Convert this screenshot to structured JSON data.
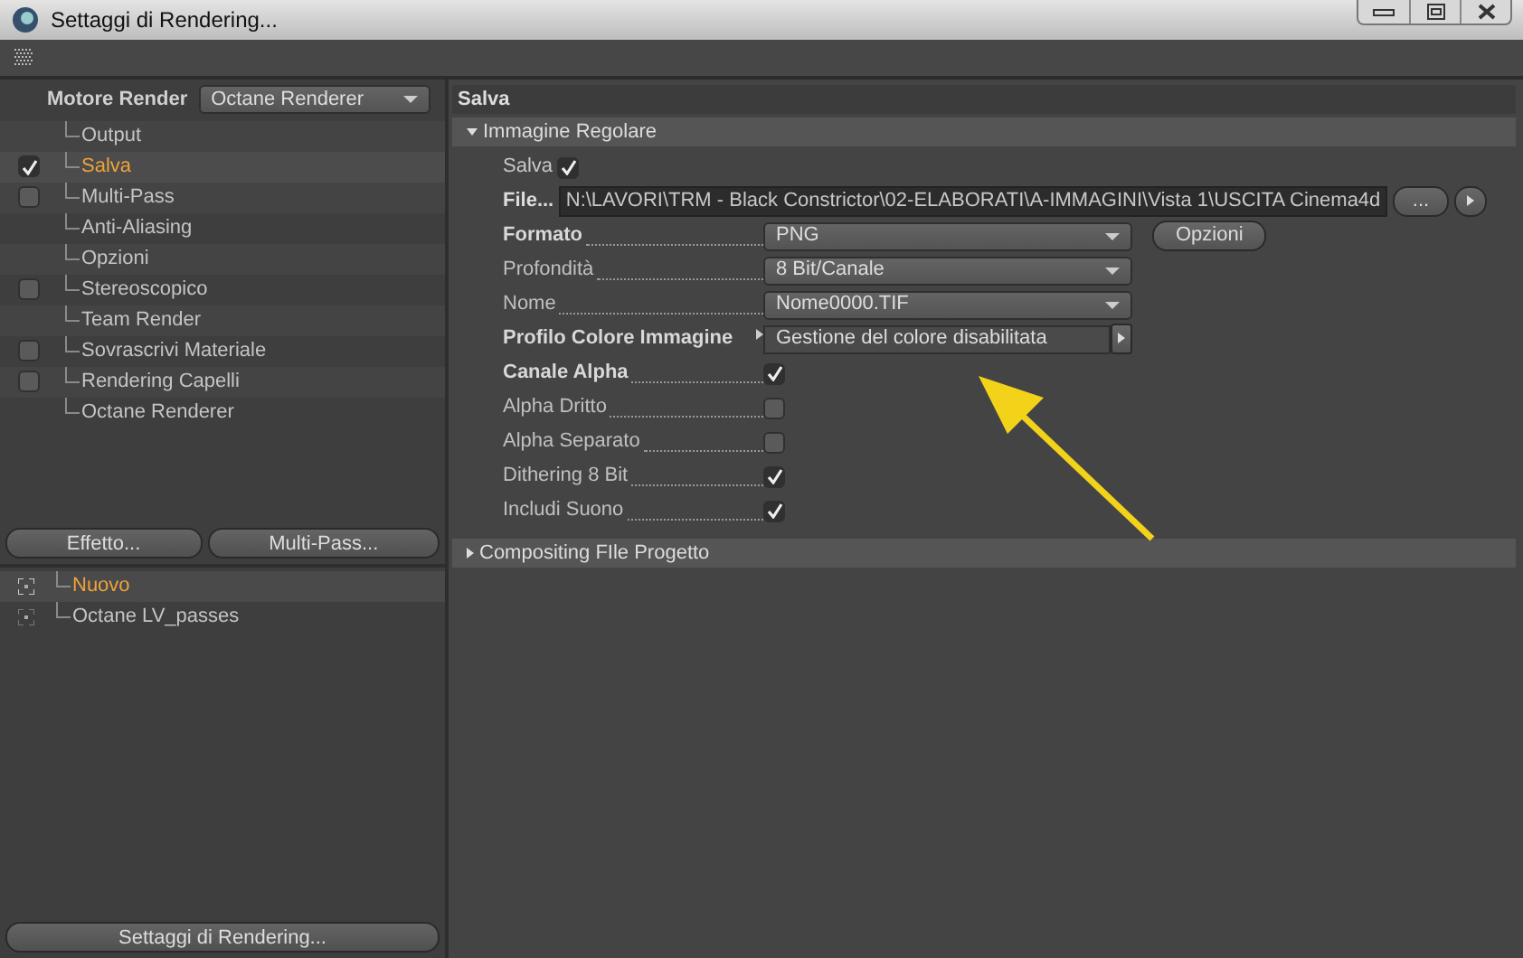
{
  "window": {
    "title": "Settaggi di Rendering..."
  },
  "sidebar": {
    "engine_label": "Motore Render",
    "engine_value": "Octane Renderer",
    "items": [
      {
        "label": "Output",
        "kind": "plain",
        "selected": false
      },
      {
        "label": "Salva",
        "kind": "checkbox",
        "checked": true,
        "selected": true
      },
      {
        "label": "Multi-Pass",
        "kind": "checkbox",
        "checked": false,
        "selected": false
      },
      {
        "label": "Anti-Aliasing",
        "kind": "plain",
        "selected": false
      },
      {
        "label": "Opzioni",
        "kind": "plain",
        "selected": false
      },
      {
        "label": "Stereoscopico",
        "kind": "checkbox",
        "checked": false,
        "selected": false
      },
      {
        "label": "Team Render",
        "kind": "plain",
        "selected": false
      },
      {
        "label": "Sovrascrivi Materiale",
        "kind": "checkbox",
        "checked": false,
        "selected": false
      },
      {
        "label": "Rendering Capelli",
        "kind": "checkbox",
        "checked": false,
        "selected": false
      },
      {
        "label": "Octane Renderer",
        "kind": "plain",
        "selected": false
      }
    ],
    "buttons": [
      "Effetto...",
      "Multi-Pass..."
    ],
    "settings": [
      {
        "label": "Nuovo",
        "selected": true
      },
      {
        "label": "Octane LV_passes",
        "selected": false
      }
    ],
    "bottom_button": "Settaggi di Rendering..."
  },
  "panel": {
    "title": "Salva",
    "sections": [
      {
        "title": "Immagine Regolare",
        "expanded": true,
        "rows": [
          {
            "kind": "inline-check",
            "label": "Salva",
            "checked": true
          },
          {
            "kind": "file",
            "label": "File...",
            "value": "N:\\LAVORI\\TRM - Black Constrictor\\02-ELABORATI\\A-IMMAGINI\\Vista 1\\USCITA Cinema4d",
            "button": "..."
          },
          {
            "kind": "dropdown",
            "label": "Formato",
            "bold": true,
            "value": "PNG",
            "button": "Opzioni"
          },
          {
            "kind": "dropdown",
            "label": "Profondità",
            "bold": false,
            "value": "8 Bit/Canale"
          },
          {
            "kind": "dropdown",
            "label": "Nome",
            "bold": false,
            "value": "Nome0000.TIF"
          },
          {
            "kind": "profile",
            "label": "Profilo Colore Immagine",
            "bold": true,
            "value": "Gestione del colore disabilitata"
          },
          {
            "kind": "check",
            "label": "Canale Alpha",
            "bold": true,
            "checked": true
          },
          {
            "kind": "check",
            "label": "Alpha Dritto",
            "bold": false,
            "checked": false
          },
          {
            "kind": "check",
            "label": "Alpha Separato",
            "bold": false,
            "checked": false
          },
          {
            "kind": "check",
            "label": "Dithering 8 Bit",
            "bold": false,
            "checked": true
          },
          {
            "kind": "check",
            "label": "Includi Suono",
            "bold": false,
            "checked": true
          }
        ]
      },
      {
        "title": "Compositing FIle Progetto",
        "expanded": false
      }
    ]
  }
}
